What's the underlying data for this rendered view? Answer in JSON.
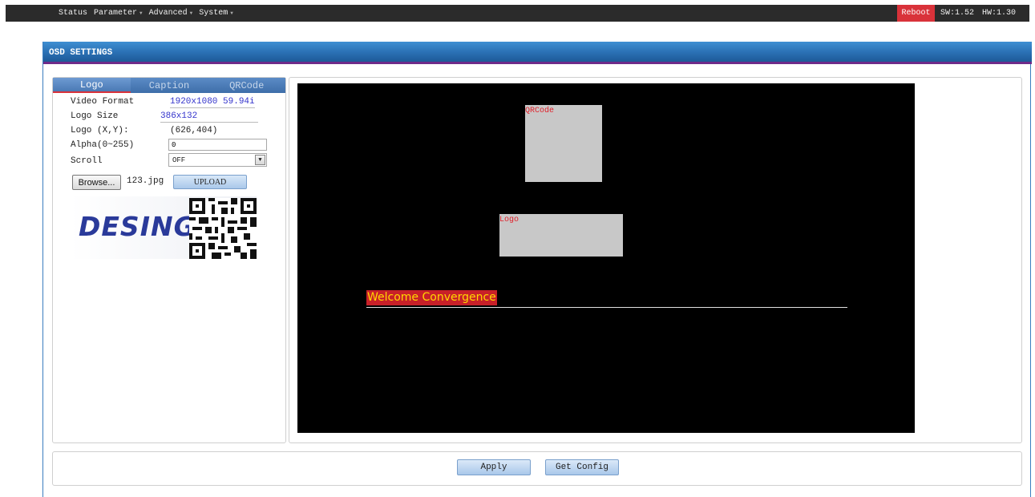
{
  "topbar": {
    "nav": [
      {
        "label": "Status",
        "has_dropdown": false
      },
      {
        "label": "Parameter",
        "has_dropdown": true
      },
      {
        "label": "Advanced",
        "has_dropdown": true
      },
      {
        "label": "System",
        "has_dropdown": true
      }
    ],
    "reboot_label": "Reboot",
    "sw_version": "SW:1.52",
    "hw_version": "HW:1.30",
    "colors": {
      "bar": "#2b2b2b",
      "reboot": "#d9323a"
    }
  },
  "panel": {
    "title": "OSD SETTINGS"
  },
  "tabs": [
    {
      "label": "Logo",
      "active": true
    },
    {
      "label": "Caption",
      "active": false
    },
    {
      "label": "QRCode",
      "active": false
    }
  ],
  "settings": {
    "video_format": {
      "label": "Video Format",
      "value": "1920x1080 59.94i"
    },
    "logo_size": {
      "label": "Logo Size",
      "value": "386x132"
    },
    "logo_xy": {
      "label": "Logo (X,Y):",
      "value": "(626,404)"
    },
    "alpha": {
      "label": "Alpha(0~255)",
      "value": "0"
    },
    "scroll": {
      "label": "Scroll",
      "value": "OFF"
    }
  },
  "file": {
    "browse_label": "Browse...",
    "filename": "123.jpg",
    "upload_label": "UPLOAD"
  },
  "logo_preview": {
    "brand_text": "DESING",
    "icons": [
      "desing-logo",
      "qr-code-icon"
    ]
  },
  "preview": {
    "qrcode_label": "QRCode",
    "logo_label": "Logo",
    "caption_text": "Welcome Convergence",
    "colors": {
      "screen": "#000000",
      "region": "#c8c8c8",
      "region_label": "#e0202a",
      "caption_bg": "#c82028",
      "caption_text": "#ffd800"
    }
  },
  "actions": {
    "apply_label": "Apply",
    "get_config_label": "Get Config"
  }
}
